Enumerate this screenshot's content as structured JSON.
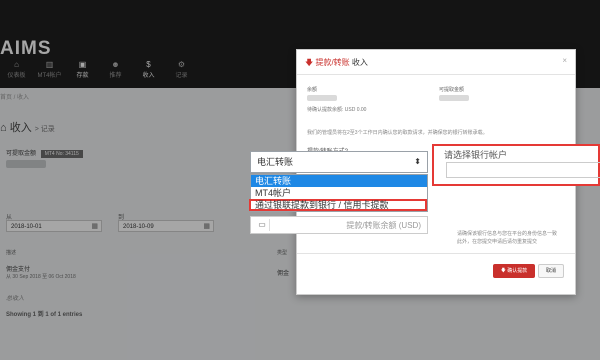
{
  "app": {
    "logo": "AIMS",
    "nav": [
      {
        "icon": "home-icon",
        "glyph": "⌂",
        "label": "仪表板"
      },
      {
        "icon": "chart-icon",
        "glyph": "▥",
        "label": "MT4帐户"
      },
      {
        "icon": "wallet-icon",
        "glyph": "▣",
        "label": "存款",
        "active": true
      },
      {
        "icon": "users-icon",
        "glyph": "☻",
        "label": "推荐"
      },
      {
        "icon": "dollar-icon",
        "glyph": "$",
        "label": "收入",
        "active": true
      },
      {
        "icon": "gear-icon",
        "glyph": "⚙",
        "label": "记录"
      }
    ]
  },
  "breadcrumb": "首页 / 收入",
  "page": {
    "title": "收入",
    "subtitle": "记录",
    "account_label": "可提取金额",
    "account_badge": "MT4 No: 34115",
    "from_label": "从",
    "to_label": "到",
    "from_date": "2018-10-01",
    "to_date": "2018-10-09",
    "table": {
      "col_desc": "描述",
      "col_type": "类型",
      "row_desc": "佣金支付",
      "row_date": "从 30 Sep 2018 至 06 Oct 2018",
      "row_type": "佣金",
      "empty": "总收入",
      "showing": "Showing 1 到 1 of 1 entries"
    }
  },
  "modal": {
    "title_red": "提款/转账",
    "title_rest": "收入",
    "balance_label": "余额",
    "withdrawable_label": "可提取金额",
    "available_text": "待确认提款余额: USD 0.00",
    "note": "我们的管理员将在2至3个工作日内确认您的取款请求，并确保您的银行转账承载。",
    "method_label": "提款/转账方式?",
    "note2": "请确保该银行信息与您在平台的身份信息一致",
    "note3": "此外，在您提交申请后请勿重复提交",
    "confirm_button": "确认提款",
    "cancel_button": "取消"
  },
  "select": {
    "value": "电汇转账",
    "options": [
      "电汇转账",
      "MT4帐户",
      "通过银联提款到银行 / 信用卡提款"
    ],
    "amount_placeholder": "提款/转账余额 (USD)"
  },
  "bank": {
    "label": "请选择银行帐户"
  },
  "colors": {
    "accent": "#c9302c",
    "highlight": "#e53935",
    "selected": "#1e88e5",
    "topbar": "#1f1f1f"
  }
}
